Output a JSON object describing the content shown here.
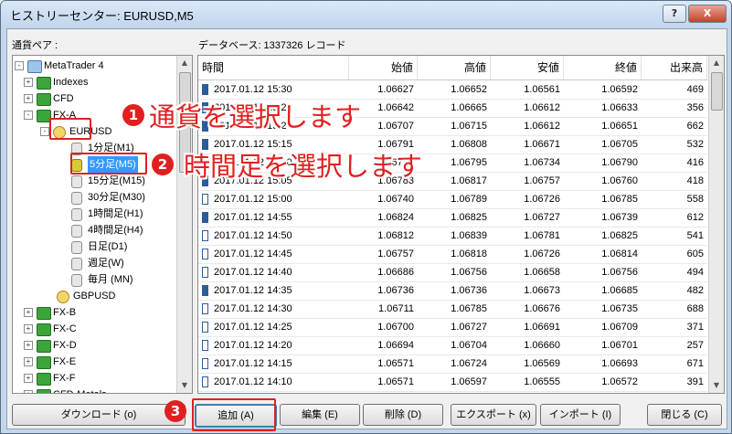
{
  "window": {
    "title": "ヒストリーセンター: EURUSD,M5",
    "help_btn": "?",
    "close_btn": "X"
  },
  "left_label": "通貨ペア :",
  "db_label": "データベース: 1337326 レコード",
  "tree": [
    {
      "label": "MetaTrader 4",
      "icon": "terminal-icon",
      "expander": "-"
    },
    {
      "label": "Indexes",
      "icon": "folder-icon",
      "expander": "+"
    },
    {
      "label": "CFD",
      "icon": "folder-icon",
      "expander": "+"
    },
    {
      "label": "FX-A",
      "icon": "folder-icon",
      "expander": "-"
    },
    {
      "label": "EURUSD",
      "icon": "symbol-icon",
      "expander": "-"
    },
    {
      "label": "1分足(M1)",
      "icon": "database-icon"
    },
    {
      "label": "5分足(M5)",
      "icon": "database-icon"
    },
    {
      "label": "15分足(M15)",
      "icon": "database-icon"
    },
    {
      "label": "30分足(M30)",
      "icon": "database-icon"
    },
    {
      "label": "1時間足(H1)",
      "icon": "database-icon"
    },
    {
      "label": "4時間足(H4)",
      "icon": "database-icon"
    },
    {
      "label": "日足(D1)",
      "icon": "database-icon"
    },
    {
      "label": "週足(W)",
      "icon": "database-icon"
    },
    {
      "label": "毎月 (MN)",
      "icon": "database-icon"
    },
    {
      "label": "GBPUSD",
      "icon": "symbol-icon"
    },
    {
      "label": "FX-B",
      "icon": "folder-icon",
      "expander": "+"
    },
    {
      "label": "FX-C",
      "icon": "folder-icon",
      "expander": "+"
    },
    {
      "label": "FX-D",
      "icon": "folder-icon",
      "expander": "+"
    },
    {
      "label": "FX-E",
      "icon": "folder-icon",
      "expander": "+"
    },
    {
      "label": "FX-F",
      "icon": "folder-icon",
      "expander": "+"
    },
    {
      "label": "CFD-Metals",
      "icon": "folder-icon",
      "expander": "+"
    }
  ],
  "columns": [
    "時間",
    "始値",
    "高値",
    "安値",
    "終値",
    "出来高"
  ],
  "rows": [
    {
      "time": "2017.01.12 15:30",
      "open": "1.06627",
      "high": "1.06652",
      "low": "1.06561",
      "close": "1.06592",
      "volume": "469"
    },
    {
      "time": "2017.01.12 15:25",
      "open": "1.06642",
      "high": "1.06665",
      "low": "1.06612",
      "close": "1.06633",
      "volume": "356"
    },
    {
      "time": "2017.01.12 15:20",
      "open": "1.06707",
      "high": "1.06715",
      "low": "1.06612",
      "close": "1.06651",
      "volume": "662"
    },
    {
      "time": "2017.01.12 15:15",
      "open": "1.06791",
      "high": "1.06808",
      "low": "1.06671",
      "close": "1.06705",
      "volume": "532"
    },
    {
      "time": "2017.01.12 15:10",
      "open": "1.06759",
      "high": "1.06795",
      "low": "1.06734",
      "close": "1.06790",
      "volume": "416"
    },
    {
      "time": "2017.01.12 15:05",
      "open": "1.06783",
      "high": "1.06817",
      "low": "1.06757",
      "close": "1.06760",
      "volume": "418"
    },
    {
      "time": "2017.01.12 15:00",
      "open": "1.06740",
      "high": "1.06789",
      "low": "1.06726",
      "close": "1.06785",
      "volume": "558"
    },
    {
      "time": "2017.01.12 14:55",
      "open": "1.06824",
      "high": "1.06825",
      "low": "1.06727",
      "close": "1.06739",
      "volume": "612"
    },
    {
      "time": "2017.01.12 14:50",
      "open": "1.06812",
      "high": "1.06839",
      "low": "1.06781",
      "close": "1.06825",
      "volume": "541"
    },
    {
      "time": "2017.01.12 14:45",
      "open": "1.06757",
      "high": "1.06818",
      "low": "1.06726",
      "close": "1.06814",
      "volume": "605"
    },
    {
      "time": "2017.01.12 14:40",
      "open": "1.06686",
      "high": "1.06756",
      "low": "1.06658",
      "close": "1.06756",
      "volume": "494"
    },
    {
      "time": "2017.01.12 14:35",
      "open": "1.06736",
      "high": "1.06736",
      "low": "1.06673",
      "close": "1.06685",
      "volume": "482"
    },
    {
      "time": "2017.01.12 14:30",
      "open": "1.06711",
      "high": "1.06785",
      "low": "1.06676",
      "close": "1.06735",
      "volume": "688"
    },
    {
      "time": "2017.01.12 14:25",
      "open": "1.06700",
      "high": "1.06727",
      "low": "1.06691",
      "close": "1.06709",
      "volume": "371"
    },
    {
      "time": "2017.01.12 14:20",
      "open": "1.06694",
      "high": "1.06704",
      "low": "1.06660",
      "close": "1.06701",
      "volume": "257"
    },
    {
      "time": "2017.01.12 14:15",
      "open": "1.06571",
      "high": "1.06724",
      "low": "1.06569",
      "close": "1.06693",
      "volume": "671"
    },
    {
      "time": "2017.01.12 14:10",
      "open": "1.06571",
      "high": "1.06597",
      "low": "1.06555",
      "close": "1.06572",
      "volume": "391"
    }
  ],
  "buttons": {
    "download": "ダウンロード (o)",
    "add": "追加 (A)",
    "edit": "編集 (E)",
    "delete": "削除 (D)",
    "export": "エクスポート (x)",
    "import": "インポート (I)",
    "close": "閉じる (C)"
  },
  "annotations": {
    "step1_num": "1",
    "step1_text": "通貨を選択します",
    "step2_num": "2",
    "step2_text": "時間足を選択します",
    "step3_num": "3"
  },
  "colors": {
    "annotation_red": "#e02020",
    "title_bar": "#c2d6ee"
  }
}
